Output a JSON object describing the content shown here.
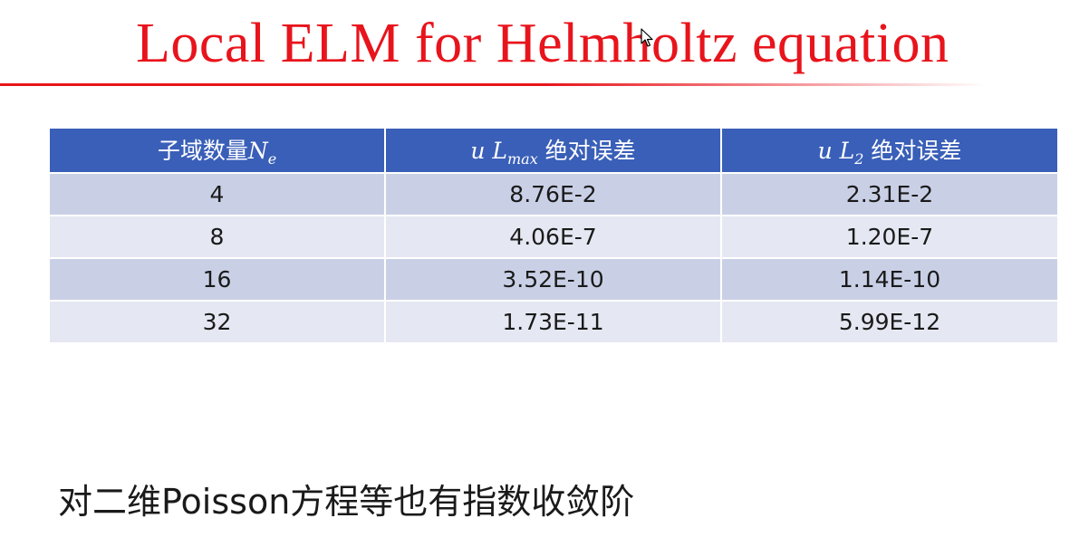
{
  "slide": {
    "title": "Local ELM for Helmholtz equation",
    "footer_text": "对二维Poisson方程等也有指数收敛阶"
  },
  "table": {
    "headers": [
      {
        "prefix": "子域数量",
        "math": "N",
        "sub": "e",
        "suffix": ""
      },
      {
        "prefix": "",
        "math": "u L",
        "sub": "max",
        "suffix": " 绝对误差"
      },
      {
        "prefix": "",
        "math": "u L",
        "sub": "2",
        "suffix": " 绝对误差"
      }
    ],
    "rows": [
      [
        "4",
        "8.76E-2",
        "2.31E-2"
      ],
      [
        "8",
        "4.06E-7",
        "1.20E-7"
      ],
      [
        "16",
        "3.52E-10",
        "1.14E-10"
      ],
      [
        "32",
        "1.73E-11",
        "5.99E-12"
      ]
    ]
  },
  "colors": {
    "title": "#e8141c",
    "header_bg": "#3a5fb8",
    "row_odd_bg": "#c9d0e6",
    "row_even_bg": "#e5e8f2"
  },
  "icons": {
    "cursor": "mouse-pointer-icon"
  }
}
